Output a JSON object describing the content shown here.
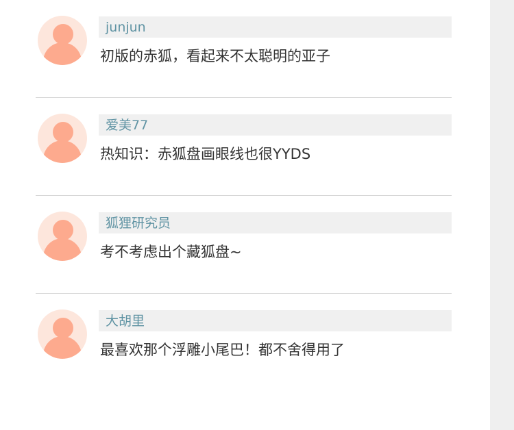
{
  "comments": [
    {
      "username": "junjun",
      "text": "初版的赤狐，看起来不太聪明的亚子"
    },
    {
      "username": "爱美77",
      "text": "热知识：赤狐盘画眼线也很YYDS"
    },
    {
      "username": "狐狸研究员",
      "text": "考不考虑出个藏狐盘~"
    },
    {
      "username": "大胡里",
      "text": "最喜欢那个浮雕小尾巴！都不舍得用了"
    }
  ],
  "colors": {
    "username": "#5f93a3",
    "name_bar_bg": "#f0f0f0",
    "avatar_bg": "#fde6dc",
    "avatar_figure": "#fdaa8e",
    "divider": "#d6d6d6",
    "side_panel": "#efefef"
  },
  "icons": {
    "avatar": "default-user-avatar-icon"
  }
}
